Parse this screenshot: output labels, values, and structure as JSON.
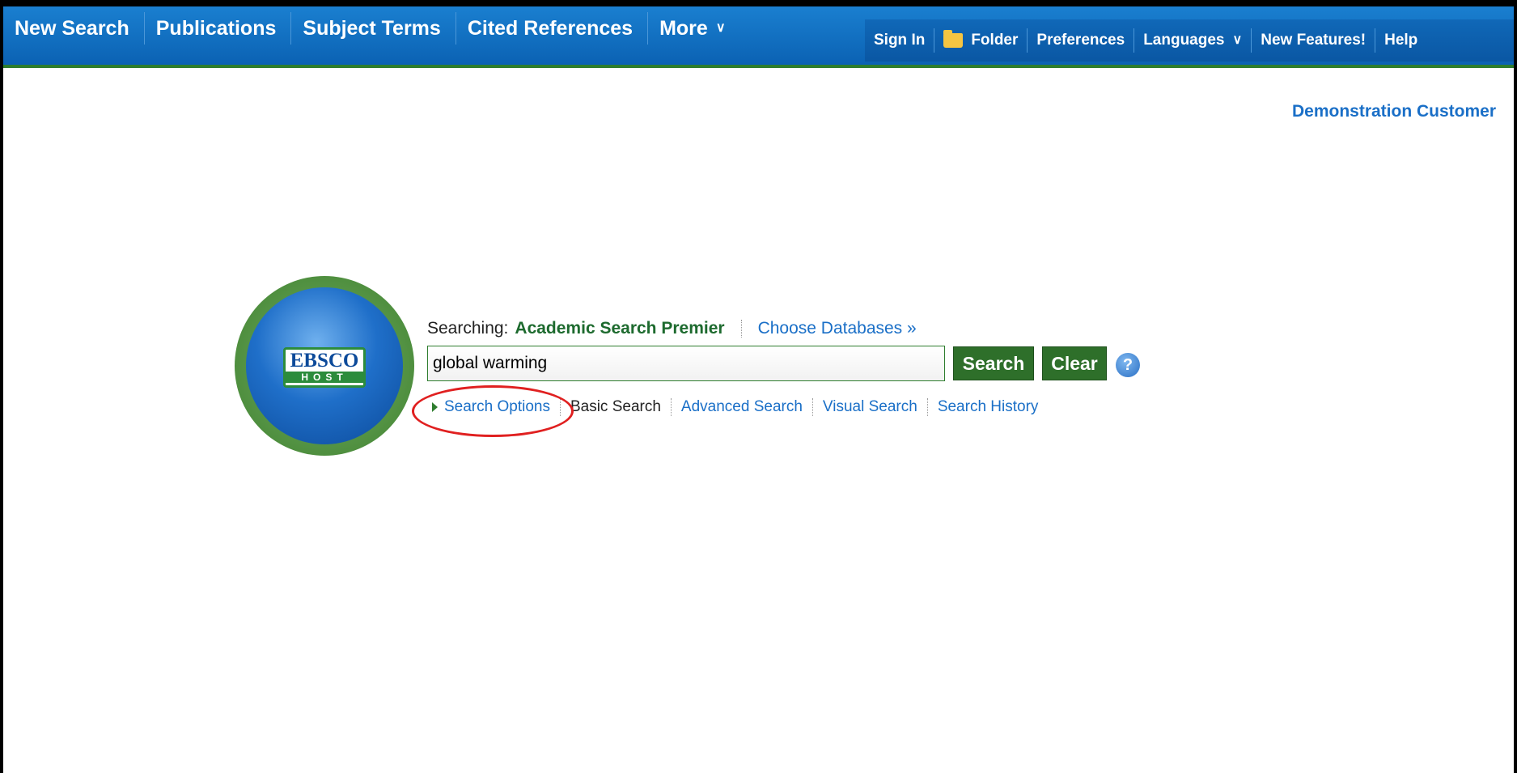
{
  "nav": {
    "main": [
      {
        "label": "New Search"
      },
      {
        "label": "Publications"
      },
      {
        "label": "Subject Terms"
      },
      {
        "label": "Cited References"
      },
      {
        "label": "More"
      }
    ],
    "utility": {
      "sign_in": "Sign In",
      "folder": "Folder",
      "preferences": "Preferences",
      "languages": "Languages",
      "new_features": "New Features!",
      "help": "Help"
    }
  },
  "customer": "Demonstration Customer",
  "logo": {
    "line1": "EBSCO",
    "line2": "HOST"
  },
  "search": {
    "searching_label": "Searching:",
    "database": "Academic Search Premier",
    "choose_databases": "Choose Databases »",
    "query": "global warming",
    "search_button": "Search",
    "clear_button": "Clear",
    "help_glyph": "?"
  },
  "search_links": {
    "options": "Search Options",
    "basic": "Basic Search",
    "advanced": "Advanced Search",
    "visual": "Visual Search",
    "history": "Search History"
  },
  "colors": {
    "nav_blue": "#0b62b3",
    "accent_green": "#2e6f2a",
    "link_blue": "#1a6fc7",
    "highlight_red": "#e02020"
  }
}
